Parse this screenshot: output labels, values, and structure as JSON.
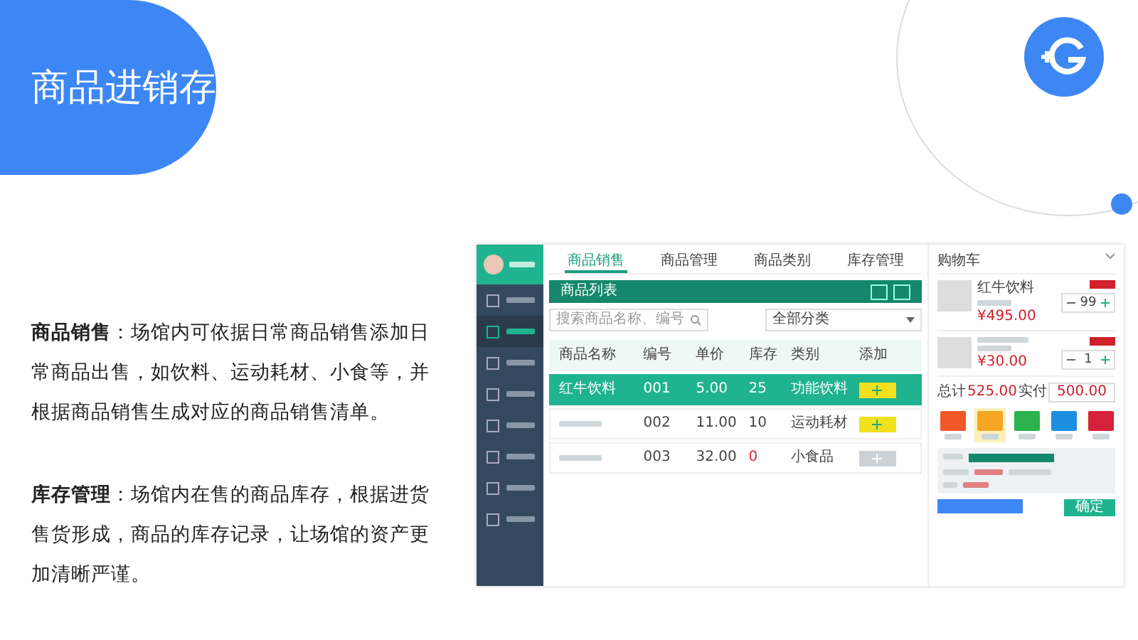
{
  "slide": {
    "title": "商品进销存"
  },
  "paragraphs": [
    "**商品销售**：场馆内可依据日常商品销售添加日常商品出售，如饮料、运动耗材、小食等，并根据商品销售生成对应的商品销售清单。",
    "**库存管理**：场馆内在售的商品库存，根据进货售货形成，商品的库存记录，让场馆的资产更加清晰严谨。"
  ],
  "app": {
    "sidebar": {
      "items": [
        {
          "selected": false
        },
        {
          "selected": true
        },
        {
          "selected": false
        },
        {
          "selected": false
        },
        {
          "selected": false
        },
        {
          "selected": false
        },
        {
          "selected": false
        },
        {
          "selected": false
        }
      ]
    },
    "tabs": [
      {
        "label": "商品销售",
        "selected": true
      },
      {
        "label": "商品管理",
        "selected": false
      },
      {
        "label": "商品类别",
        "selected": false
      },
      {
        "label": "库存管理",
        "selected": false
      }
    ],
    "list_title": "商品列表",
    "search": {
      "placeholder": "搜索商品名称、编号"
    },
    "filter": "全部分类",
    "table": {
      "columns": [
        "商品名称",
        "编号",
        "单价",
        "库存",
        "类别",
        "添加"
      ],
      "rows": [
        {
          "selected": true,
          "enabled": true,
          "low_stock": false,
          "cells": [
            "红牛饮料",
            "001",
            "5.00",
            "25",
            "功能饮料"
          ]
        },
        {
          "selected": false,
          "enabled": true,
          "low_stock": false,
          "cells": [
            null,
            "002",
            "11.00",
            "10",
            "运动耗材"
          ]
        },
        {
          "selected": false,
          "enabled": false,
          "low_stock": true,
          "cells": [
            null,
            "003",
            "32.00",
            "0",
            "小食品"
          ]
        }
      ]
    },
    "cart": {
      "title": "购物车",
      "items": [
        {
          "name": "红牛饮料",
          "price": "¥495.00",
          "qty": "99"
        },
        {
          "price": "¥30.00",
          "qty": "1"
        }
      ],
      "total_label": "总计",
      "total": "525.00",
      "paid_label": "实付",
      "paid": "500.00",
      "payments": [
        {
          "color": "#f0582a",
          "selected": false
        },
        {
          "color": "#f5a623",
          "selected": true
        },
        {
          "color": "#2bb24c",
          "selected": false
        },
        {
          "color": "#1e8fe0",
          "selected": false
        },
        {
          "color": "#d6213a",
          "selected": false
        }
      ],
      "confirm": "确定"
    }
  }
}
